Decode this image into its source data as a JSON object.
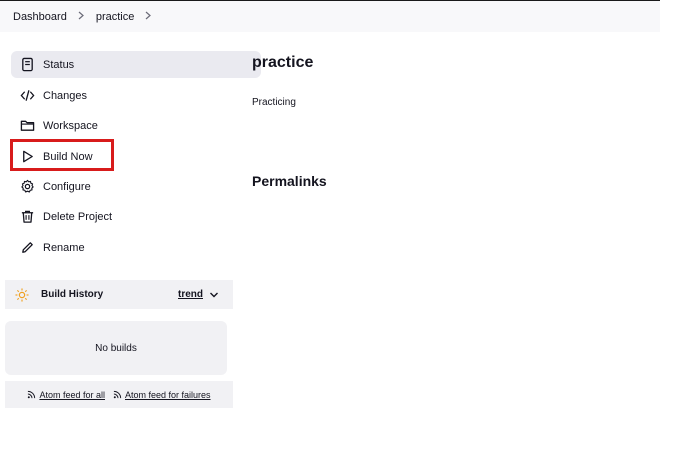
{
  "breadcrumb": {
    "items": [
      "Dashboard",
      "practice"
    ]
  },
  "sidebar": {
    "items": [
      {
        "label": "Status",
        "icon": "status-icon",
        "active": true
      },
      {
        "label": "Changes",
        "icon": "code-icon"
      },
      {
        "label": "Workspace",
        "icon": "folder-icon"
      },
      {
        "label": "Build Now",
        "icon": "play-icon"
      },
      {
        "label": "Configure",
        "icon": "gear-icon"
      },
      {
        "label": "Delete Project",
        "icon": "trash-icon"
      },
      {
        "label": "Rename",
        "icon": "pencil-icon"
      }
    ]
  },
  "build_history": {
    "title": "Build History",
    "trend_label": "trend",
    "empty_text": "No builds",
    "feeds": {
      "all": "Atom feed for all",
      "failures": "Atom feed for failures"
    }
  },
  "main": {
    "title": "practice",
    "description": "Practicing",
    "permalinks_heading": "Permalinks"
  },
  "colors": {
    "highlight": "#d81b1b",
    "active_bg": "#eaeaf0",
    "panel_bg": "#f1f1f4"
  }
}
